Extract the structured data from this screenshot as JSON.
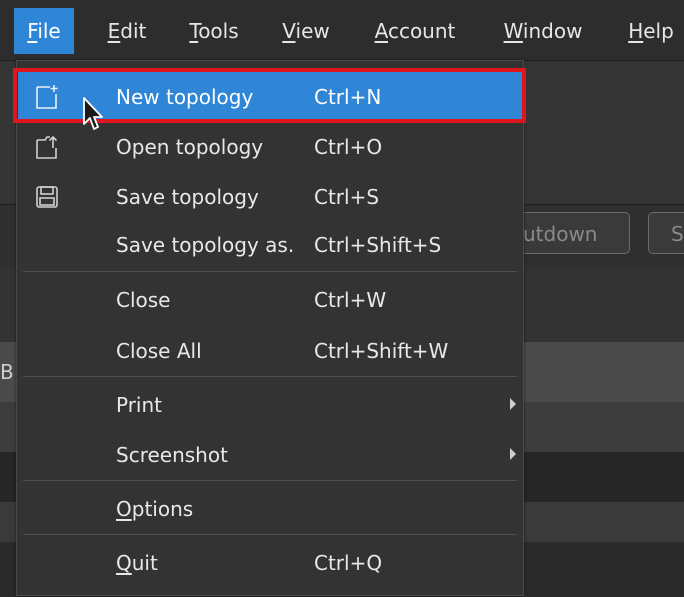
{
  "menubar": {
    "items": [
      {
        "mnemonic": "F",
        "rest": "ile"
      },
      {
        "mnemonic": "E",
        "rest": "dit"
      },
      {
        "mnemonic": "T",
        "rest": "ools"
      },
      {
        "mnemonic": "V",
        "rest": "iew"
      },
      {
        "mnemonic": "A",
        "rest": "ccount"
      },
      {
        "mnemonic": "W",
        "rest": "indow"
      },
      {
        "mnemonic": "H",
        "rest": "elp"
      }
    ]
  },
  "background": {
    "button1": "utdown",
    "button2": "S",
    "edge_letter": "B"
  },
  "file_menu": {
    "new_topology": {
      "label": "New topology",
      "shortcut": "Ctrl+N",
      "icon": "new-file-icon"
    },
    "open_topology": {
      "label": "Open topology",
      "shortcut": "Ctrl+O",
      "icon": "open-file-icon"
    },
    "save_topology": {
      "label": "Save topology",
      "shortcut": "Ctrl+S",
      "icon": "save-icon"
    },
    "save_topology_as": {
      "label": "Save topology as.",
      "shortcut": "Ctrl+Shift+S"
    },
    "close": {
      "label": "Close",
      "shortcut": "Ctrl+W"
    },
    "close_all": {
      "label": "Close All",
      "shortcut": "Ctrl+Shift+W"
    },
    "print": {
      "label": "Print"
    },
    "screenshot": {
      "label": "Screenshot"
    },
    "options": {
      "mnemonic": "O",
      "rest": "ptions"
    },
    "quit": {
      "mnemonic": "Q",
      "rest": "uit",
      "shortcut": "Ctrl+Q"
    }
  },
  "colors": {
    "highlight": "#2f86d6",
    "annotation_red": "#e0161e"
  }
}
